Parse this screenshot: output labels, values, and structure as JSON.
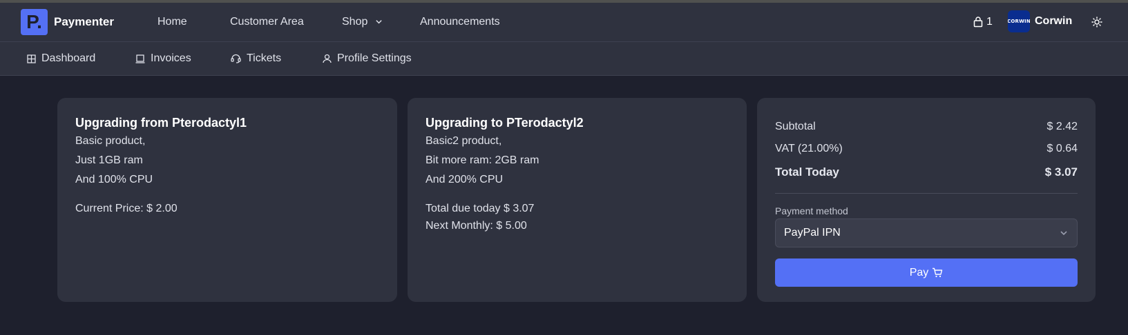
{
  "brand": {
    "logo_letter": "P.",
    "name": "Paymenter"
  },
  "nav": {
    "home": "Home",
    "customer_area": "Customer Area",
    "shop": "Shop",
    "announcements": "Announcements"
  },
  "user": {
    "cart_count": "1",
    "avatar_text": "CORWIN",
    "name": "Corwin"
  },
  "subnav": {
    "dashboard": "Dashboard",
    "invoices": "Invoices",
    "tickets": "Tickets",
    "profile": "Profile Settings"
  },
  "from_card": {
    "title": "Upgrading from Pterodactyl1",
    "lines": [
      "Basic product,",
      "Just 1GB ram",
      "And 100% CPU"
    ],
    "price": "Current Price: $ 2.00"
  },
  "to_card": {
    "title": "Upgrading to PTerodactyl2",
    "lines": [
      "Basic2 product,",
      "Bit more ram: 2GB ram",
      "And 200% CPU"
    ],
    "due_today": "Total due today $ 3.07",
    "next_monthly": "Next Monthly: $ 5.00"
  },
  "summary": {
    "subtotal_label": "Subtotal",
    "subtotal_value": "$ 2.42",
    "vat_label": "VAT (21.00%)",
    "vat_value": "$ 0.64",
    "total_label": "Total Today",
    "total_value": "$ 3.07",
    "payment_label": "Payment method",
    "payment_selected": "PayPal IPN",
    "pay_label": "Pay"
  },
  "colors": {
    "accent": "#5470f5",
    "background": "#1e202d",
    "surface": "#2f323f"
  }
}
